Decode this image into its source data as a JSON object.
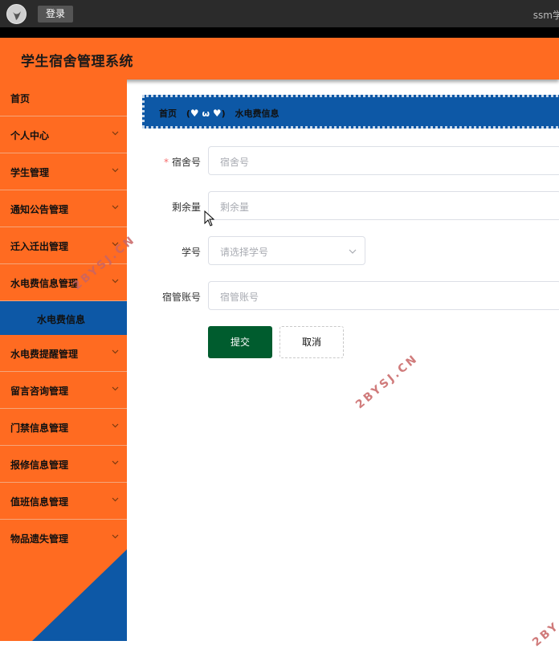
{
  "topbar": {
    "login_label": "登录",
    "right_title": "ssm学"
  },
  "header": {
    "title": "学生宿舍管理系统"
  },
  "sidebar": {
    "items": [
      {
        "label": "首页",
        "has_arrow": false
      },
      {
        "label": "个人中心",
        "has_arrow": true
      },
      {
        "label": "学生管理",
        "has_arrow": true
      },
      {
        "label": "通知公告管理",
        "has_arrow": true
      },
      {
        "label": "迁入迁出管理",
        "has_arrow": true
      },
      {
        "label": "水电费信息管理",
        "has_arrow": true
      },
      {
        "label": "水电费信息",
        "sub": true
      },
      {
        "label": "水电费提醒管理",
        "has_arrow": true
      },
      {
        "label": "留言咨询管理",
        "has_arrow": true
      },
      {
        "label": "门禁信息管理",
        "has_arrow": true
      },
      {
        "label": "报修信息管理",
        "has_arrow": true
      },
      {
        "label": "值班信息管理",
        "has_arrow": true
      },
      {
        "label": "物品遗失管理",
        "has_arrow": true
      }
    ]
  },
  "breadcrumb": {
    "home": "首页",
    "emoticon_left": "(",
    "emoticon_mid": "ω",
    "emoticon_right": ")",
    "current": "水电费信息"
  },
  "form": {
    "fields": [
      {
        "label": "宿舍号",
        "placeholder": "宿舍号",
        "required": true
      },
      {
        "label": "剩余量",
        "placeholder": "剩余量",
        "required": false
      },
      {
        "label": "学号",
        "placeholder": "请选择学号",
        "required": false,
        "type": "select"
      },
      {
        "label": "宿管账号",
        "placeholder": "宿管账号",
        "required": false
      }
    ],
    "required_mark": "*",
    "submit_label": "提交",
    "cancel_label": "取消"
  },
  "watermark": {
    "text": "2BYSJ.CN",
    "partial_text": "2BY"
  },
  "colors": {
    "accent_orange": "#ff6b21",
    "accent_blue": "#0d58a6",
    "submit_green": "#005c2e",
    "topbar": "#2b2b2b"
  }
}
